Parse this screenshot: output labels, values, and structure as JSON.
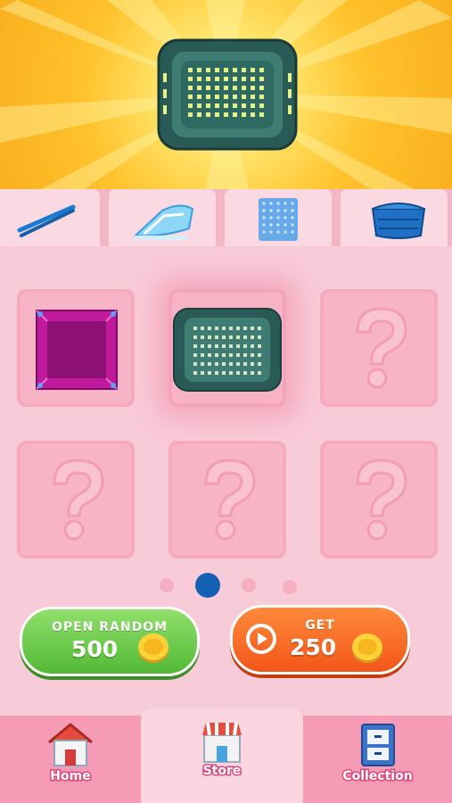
{
  "hero": {
    "item_icon": "green-basket-icon"
  },
  "tool_tabs": [
    {
      "icon": "tweezers-icon"
    },
    {
      "icon": "iron-icon"
    },
    {
      "icon": "blue-mat-icon"
    },
    {
      "icon": "blue-basket-icon"
    }
  ],
  "grid": {
    "slots": [
      {
        "icon": "magenta-box-icon",
        "state": "unlocked"
      },
      {
        "icon": "green-basket-icon",
        "state": "selected"
      },
      {
        "icon": "question-mark-icon",
        "state": "locked"
      },
      {
        "icon": "question-mark-icon",
        "state": "locked"
      },
      {
        "icon": "question-mark-icon",
        "state": "locked"
      },
      {
        "icon": "question-mark-icon",
        "state": "locked"
      }
    ]
  },
  "pagination": {
    "pages": 4,
    "current": 2
  },
  "buttons": {
    "open_random": {
      "label": "OPEN RANDOM",
      "price": "500",
      "icon": "coin-icon"
    },
    "get": {
      "label": "GET",
      "amount": "250",
      "icon": "coin-icon",
      "play_icon": "play-icon"
    }
  },
  "nav": {
    "items": [
      {
        "label": "Home",
        "icon": "house-icon"
      },
      {
        "label": "Store",
        "icon": "store-icon"
      },
      {
        "label": "Collection",
        "icon": "drawer-cabinet-icon"
      }
    ],
    "active": "Store"
  },
  "colors": {
    "accent_blue": "#1461b4",
    "green_button": "#5cc23c",
    "orange_button": "#f6621f",
    "pink_panel": "#f8cbd8"
  }
}
